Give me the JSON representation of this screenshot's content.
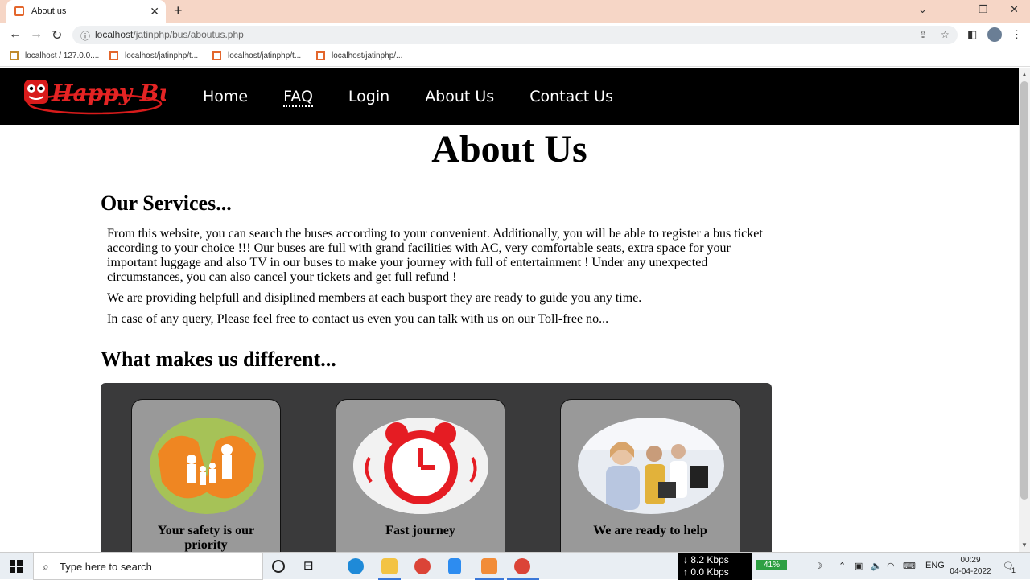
{
  "browser": {
    "tab_title": "About us",
    "url_host": "localhost",
    "url_path": "/jatinphp/bus/aboutus.php",
    "bookmarks": [
      "localhost / 127.0.0....",
      "localhost/jatinphp/t...",
      "localhost/jatinphp/t...",
      "localhost/jatinphp/..."
    ]
  },
  "site": {
    "logo_text": "Happy Bus",
    "nav": [
      "Home",
      "FAQ",
      "Login",
      "About Us",
      "Contact Us"
    ]
  },
  "page": {
    "title": "About Us",
    "services_heading": "Our Services...",
    "services_p1": "From this website, you can search the buses according to your convenient. Additionally, you will be able to register a bus ticket according to your choice !!! Our buses are full with grand facilities with AC, very comfortable seats, extra space for your important luggage and also TV in our buses to make your journey with full of entertainment ! Under any unexpected circumstances, you can also cancel your tickets and get full refund !",
    "services_p2": "We are providing helpfull and disiplined members at each busport they are ready to guide you any time.",
    "services_p3": "In case of any query, Please feel free to contact us even you can talk with us on our Toll-free no...",
    "different_heading": "What makes us different...",
    "cards": [
      {
        "title": "Your safety is our priority"
      },
      {
        "title": "Fast journey"
      },
      {
        "title": "We are ready to help"
      }
    ]
  },
  "taskbar": {
    "search_placeholder": "Type here to search",
    "net_down": "8.2 Kbps",
    "net_up": "0.0 Kbps",
    "battery": "41%",
    "lang": "ENG",
    "time": "00:29",
    "date": "04-04-2022",
    "notif_count": "1"
  }
}
